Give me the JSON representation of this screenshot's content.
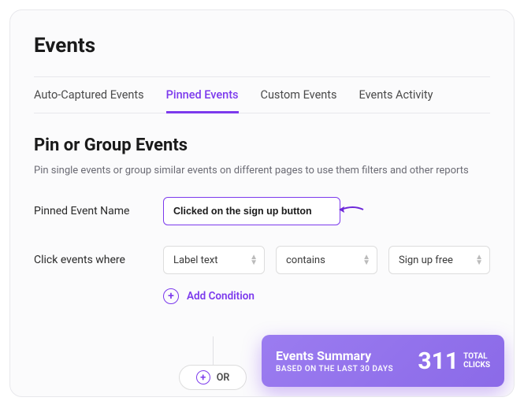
{
  "page": {
    "title": "Events"
  },
  "tabs": [
    {
      "label": "Auto-Captured Events",
      "active": false
    },
    {
      "label": "Pinned Events",
      "active": true
    },
    {
      "label": "Custom Events",
      "active": false
    },
    {
      "label": "Events Activity",
      "active": false
    }
  ],
  "section": {
    "title": "Pin or Group Events",
    "description": "Pin single events or group similar events on different pages to use them filters and other reports"
  },
  "form": {
    "name_label": "Pinned Event Name",
    "name_value": "Clicked on the sign up button",
    "where_label": "Click events where",
    "attribute": "Label text",
    "operator": "contains",
    "value": "Sign up free",
    "add_condition": "Add Condition",
    "or_label": "OR"
  },
  "summary": {
    "title": "Events Summary",
    "subtitle": "BASED ON THE LAST 30 DAYS",
    "count": "311",
    "unit_line1": "TOTAL",
    "unit_line2": "CLICKS"
  }
}
